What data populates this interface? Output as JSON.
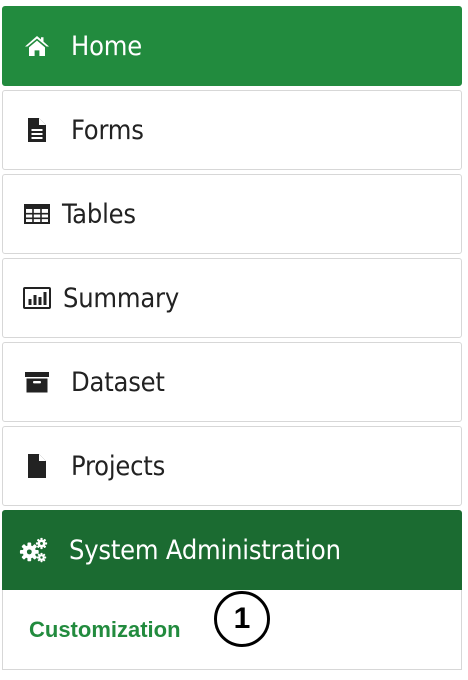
{
  "nav": {
    "items": [
      {
        "label": "Home",
        "icon": "home-icon"
      },
      {
        "label": "Forms",
        "icon": "document-icon"
      },
      {
        "label": "Tables",
        "icon": "table-icon"
      },
      {
        "label": "Summary",
        "icon": "bar-chart-icon"
      },
      {
        "label": "Dataset",
        "icon": "archive-icon"
      },
      {
        "label": "Projects",
        "icon": "file-icon"
      },
      {
        "label": "System Administration",
        "icon": "gears-icon"
      }
    ],
    "submenu": {
      "items": [
        {
          "label": "Customization"
        }
      ]
    }
  },
  "callout": {
    "number": "1"
  },
  "colors": {
    "home_bg": "#228b3e",
    "sysadmin_bg": "#1b6b31",
    "submenu_text": "#228b3e",
    "border": "#d7d7d7"
  }
}
